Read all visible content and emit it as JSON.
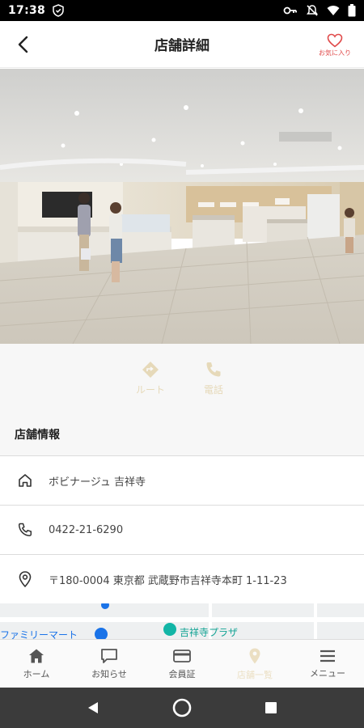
{
  "status_bar": {
    "time": "17:38"
  },
  "header": {
    "title": "店舗詳細",
    "favorite_label": "お気に入り",
    "accent_color": "#e04a4a"
  },
  "actions": [
    {
      "icon": "route-icon",
      "label": "ルート"
    },
    {
      "icon": "phone-icon",
      "label": "電話"
    }
  ],
  "store_info": {
    "section_title": "店舗情報",
    "name": "ボビナージュ 吉祥寺",
    "phone": "0422-21-6290",
    "address": "〒180-0004 東京都 武蔵野市吉祥寺本町 1-11-23"
  },
  "map": {
    "labels": [
      "ファミリーマート",
      "吉祥寺プラザ"
    ]
  },
  "bottom_nav": [
    {
      "icon": "home-icon",
      "label": "ホーム"
    },
    {
      "icon": "chat-icon",
      "label": "お知らせ"
    },
    {
      "icon": "card-icon",
      "label": "会員証"
    },
    {
      "icon": "pin-icon",
      "label": "店舗一覧"
    },
    {
      "icon": "menu-icon",
      "label": "メニュー"
    }
  ]
}
